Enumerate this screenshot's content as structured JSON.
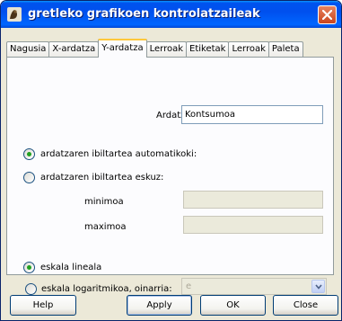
{
  "window": {
    "title": "gretleko grafikoen kontrolatzaileak"
  },
  "tabs": [
    "Nagusia",
    "X-ardatza",
    "Y-ardatza",
    "Lerroak",
    "Etiketak",
    "Lerroak",
    "Paleta"
  ],
  "active_tab_index": 2,
  "axis_title": {
    "label": "Ardatzen izenburua",
    "value": "Kontsumoa"
  },
  "range": {
    "auto_label": "ardatzaren ibiltartea automatikoki:",
    "manual_label": "ardatzaren ibiltartea eskuz:",
    "selected": "auto",
    "min_label": "minimoa",
    "min_value": "",
    "max_label": "maximoa",
    "max_value": ""
  },
  "scale": {
    "linear_label": "eskala lineala",
    "log_label": "eskala logaritmikoa, oinarria:",
    "selected": "linear",
    "log_base_value": "e"
  },
  "buttons": {
    "help": "Help",
    "apply": "Apply",
    "ok": "OK",
    "close": "Close"
  },
  "icons": {
    "app": "gretl-icon",
    "close": "close-icon",
    "dropdown": "chevron-down-icon"
  }
}
